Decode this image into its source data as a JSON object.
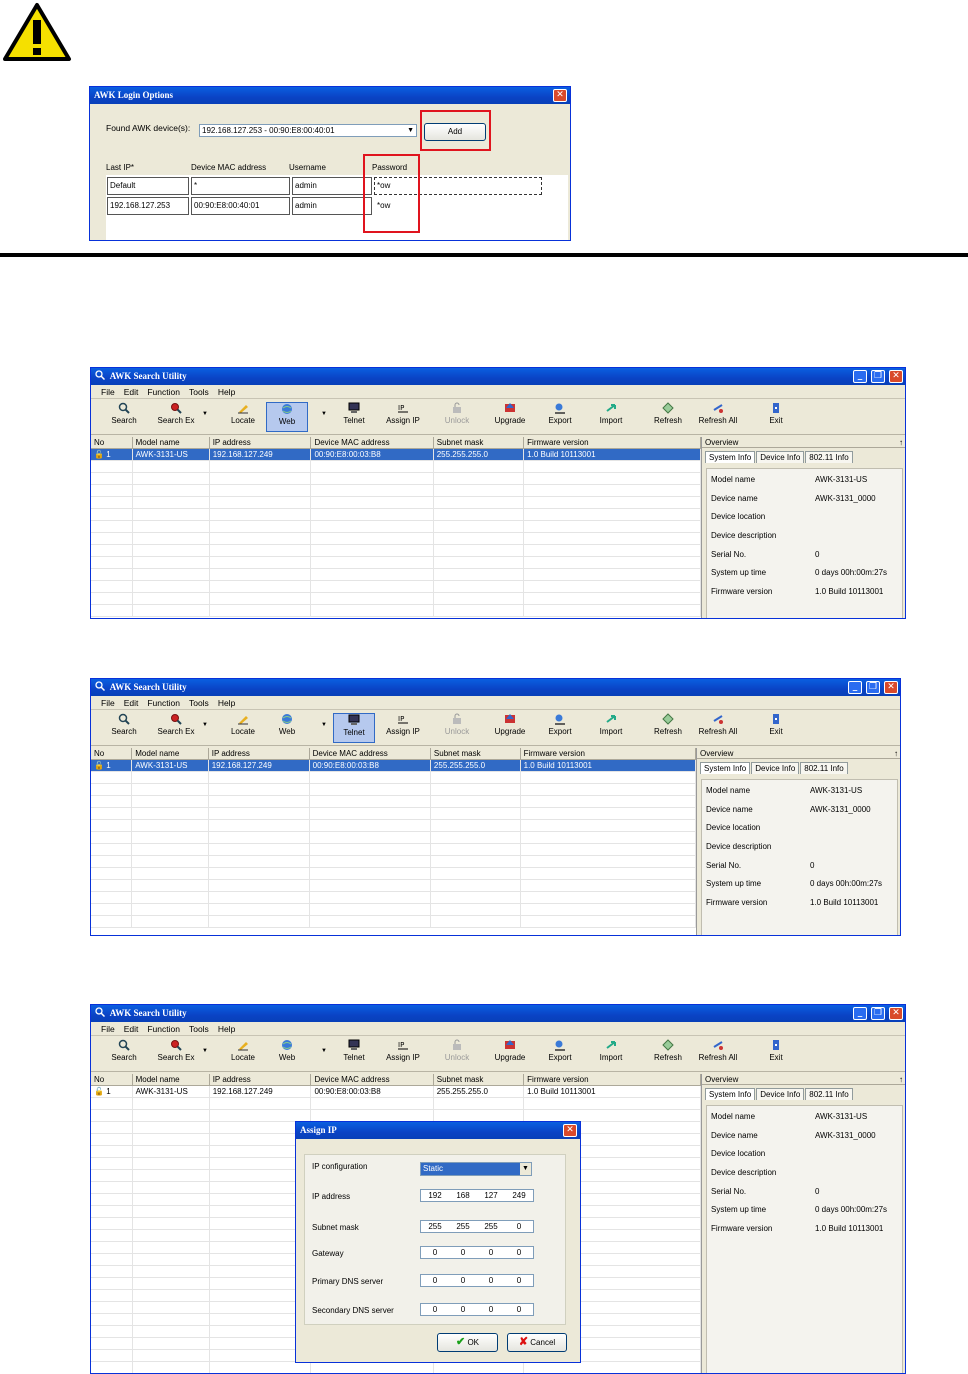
{
  "login": {
    "title": "AWK Login Options",
    "found_label": "Found AWK device(s):",
    "found_value": "192.168.127.253 - 00:90:E8:00:40:01",
    "add_label": "Add",
    "columns": [
      "Last IP*",
      "Device MAC address",
      "Username",
      "Password"
    ],
    "rows": [
      [
        "Default",
        "*",
        "admin",
        "*ow"
      ],
      [
        "192.168.127.253",
        "00:90:E8:00:40:01",
        "admin",
        "*ow"
      ]
    ]
  },
  "app": {
    "title": "AWK Search Utility",
    "menu": [
      "File",
      "Edit",
      "Function",
      "Tools",
      "Help"
    ],
    "toolbar": [
      "Search",
      "Search Ex",
      "Locate",
      "Web",
      "Telnet",
      "Assign IP",
      "Unlock",
      "Upgrade",
      "Export",
      "Import",
      "Refresh",
      "Refresh All",
      "Exit"
    ],
    "columns": [
      "No",
      "Model name",
      "IP address",
      "Device MAC address",
      "Subnet mask",
      "Firmware version"
    ],
    "row": [
      "1",
      "AWK-3131-US",
      "192.168.127.249",
      "00:90:E8:00:03:B8",
      "255.255.255.0",
      "1.0 Build 10113001"
    ],
    "overview": {
      "title": "Overview",
      "pin": "↑",
      "tabs": [
        "System Info",
        "Device Info",
        "802.11 Info"
      ],
      "rows": [
        {
          "k": "Model name",
          "v": "AWK-3131-US"
        },
        {
          "k": "Device name",
          "v": "AWK-3131_0000"
        },
        {
          "k": "Device location",
          "v": ""
        },
        {
          "k": "Device description",
          "v": ""
        },
        {
          "k": "Serial No.",
          "v": "0"
        },
        {
          "k": "System up time",
          "v": "0 days 00h:00m:27s"
        },
        {
          "k": "Firmware version",
          "v": "1.0 Build 10113001"
        }
      ]
    }
  },
  "assign_ip": {
    "title": "Assign IP",
    "ip_config_label": "IP configuration",
    "ip_config_value": "Static",
    "fields": [
      {
        "label": "IP address",
        "octets": [
          "192",
          "168",
          "127",
          "249"
        ]
      },
      {
        "label": "Subnet mask",
        "octets": [
          "255",
          "255",
          "255",
          "0"
        ]
      },
      {
        "label": "Gateway",
        "octets": [
          "0",
          "0",
          "0",
          "0"
        ]
      },
      {
        "label": "Primary DNS server",
        "octets": [
          "0",
          "0",
          "0",
          "0"
        ]
      },
      {
        "label": "Secondary DNS server",
        "octets": [
          "0",
          "0",
          "0",
          "0"
        ]
      }
    ],
    "ok_label": "OK",
    "cancel_label": "Cancel"
  }
}
